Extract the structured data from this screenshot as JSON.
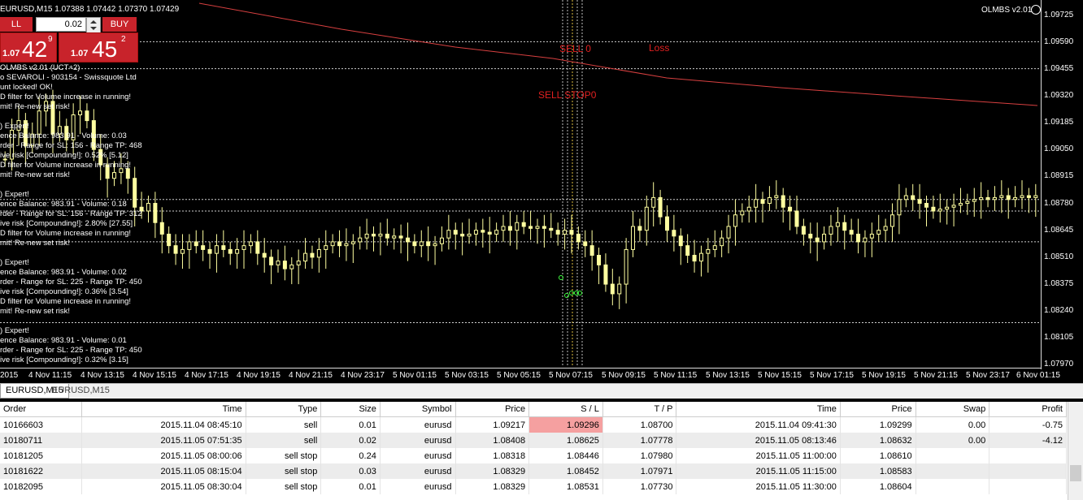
{
  "window": {
    "symbol_info": "EURUSD,M15  1.07388 1.07442 1.07370 1.07429",
    "ea_badge": "OLMBS v2.01"
  },
  "trade_panel": {
    "sell_label": "LL",
    "buy_label": "BUY",
    "lot_value": "0.02",
    "sell_quote": {
      "small": "1.07",
      "big": "42",
      "sup": "9"
    },
    "buy_quote": {
      "small": "1.07",
      "big": "45",
      "sup": "2"
    }
  },
  "comment_lines": [
    "OLMBS v2.01 (UCT+2)",
    "o SEVAROLI - 903154 - Swissquote Ltd",
    "unt locked! OK!",
    "D filter for Volume increase in running!",
    "mit! Re-new set risk!",
    "",
    ") Expert!",
    "ence Balance: 983.91 - Volume: 0.03",
    "rder - Range for SL: 156 - Range TP: 468",
    "ive risk [Compounding!]: 0.52% [5.12]",
    "D filter for Volume increase in running!",
    "mit! Re-new set risk!",
    "",
    ") Expert!",
    "ence Balance: 983.91 - Volume: 0.18",
    "rder - Range for SL: 156 - Range TP: 312",
    "ive risk [Compounding!]: 2.80% [27.55]",
    "D filter for Volume increase in running!",
    "mit! Re-new set risk!",
    "",
    ") Expert!",
    "ence Balance: 983.91 - Volume: 0.02",
    "rder - Range for SL: 225 - Range TP: 450",
    "ive risk [Compounding!]: 0.36% [3.54]",
    "D filter for Volume increase in running!",
    "mit! Re-new set risk!",
    "",
    ") Expert!",
    "ence Balance: 983.91 - Volume: 0.01",
    "rder - Range for SL: 225 - Range TP: 450",
    "ive risk [Compounding!]: 0.32% [3.15]"
  ],
  "chart_labels": {
    "sell0": "SELL 0",
    "loss": "Loss",
    "sell_stop": "SELL STOP0"
  },
  "price_ticks": [
    "1.09725",
    "1.09590",
    "1.09455",
    "1.09320",
    "1.09185",
    "1.09050",
    "1.08915",
    "1.08780",
    "1.08645",
    "1.08510",
    "1.08375",
    "1.08240",
    "1.08105",
    "1.07970"
  ],
  "time_ticks": [
    "2015",
    "4 Nov 11:15",
    "4 Nov 13:15",
    "4 Nov 15:15",
    "4 Nov 17:15",
    "4 Nov 19:15",
    "4 Nov 21:15",
    "4 Nov 23:17",
    "5 Nov 01:15",
    "5 Nov 03:15",
    "5 Nov 05:15",
    "5 Nov 07:15",
    "5 Nov 09:15",
    "5 Nov 11:15",
    "5 Nov 13:15",
    "5 Nov 15:15",
    "5 Nov 17:15",
    "5 Nov 19:15",
    "5 Nov 21:15",
    "5 Nov 23:17",
    "6 Nov 01:15"
  ],
  "chart_data": {
    "type": "candlestick",
    "symbol": "EURUSD",
    "timeframe": "M15",
    "ylim": [
      1.0797,
      1.0986
    ],
    "horizontal_levels": [
      1.0966,
      1.0952,
      1.0884,
      1.0878,
      1.0862,
      1.082
    ],
    "closes": [
      1.0905,
      1.092,
      1.0925,
      1.0912,
      1.0918,
      1.093,
      1.0935,
      1.0918,
      1.0922,
      1.0915,
      1.0928,
      1.093,
      1.0925,
      1.091,
      1.0902,
      1.0895,
      1.0898,
      1.09,
      1.0895,
      1.088,
      1.0878,
      1.0882,
      1.0872,
      1.0866,
      1.086,
      1.0856,
      1.0858,
      1.0862,
      1.086,
      1.0858,
      1.0856,
      1.086,
      1.0858,
      1.0856,
      1.0858,
      1.086,
      1.0862,
      1.0856,
      1.0854,
      1.085,
      1.0852,
      1.0848,
      1.085,
      1.0852,
      1.0856,
      1.0854,
      1.0858,
      1.086,
      1.0862,
      1.086,
      1.0861,
      1.0862,
      1.0864,
      1.0866,
      1.0865,
      1.0866,
      1.0864,
      1.0865,
      1.0864,
      1.0862,
      1.086,
      1.0862,
      1.086,
      1.0861,
      1.0864,
      1.0868,
      1.0866,
      1.0865,
      1.0866,
      1.0868,
      1.0867,
      1.0866,
      1.0868,
      1.087,
      1.0868,
      1.0872,
      1.087,
      1.0869,
      1.087,
      1.0869,
      1.0868,
      1.0866,
      1.0868,
      1.0866,
      1.0862,
      1.086,
      1.0855,
      1.085,
      1.084,
      1.0835,
      1.084,
      1.0858,
      1.087,
      1.0868,
      1.088,
      1.0885,
      1.0875,
      1.0868,
      1.0865,
      1.086,
      1.0855,
      1.0852,
      1.0856,
      1.0858,
      1.086,
      1.0864,
      1.087,
      1.0876,
      1.0878,
      1.088,
      1.0884,
      1.0882,
      1.0885,
      1.0886,
      1.088,
      1.0878,
      1.087,
      1.0866,
      1.0864,
      1.0862,
      1.0866,
      1.087,
      1.0872,
      1.0868,
      1.0866,
      1.0862,
      1.0864,
      1.0866,
      1.0868,
      1.087,
      1.0876,
      1.0884,
      1.0886,
      1.0884,
      1.0882,
      1.088,
      1.0878,
      1.0879,
      1.088,
      1.0881,
      1.0882,
      1.0883,
      1.0884,
      1.0885,
      1.0884,
      1.0885,
      1.0886,
      1.0884,
      1.0885,
      1.0886,
      1.0885,
      1.0886
    ]
  },
  "tabs": {
    "active": "EURUSD,M15",
    "inactive": "EURUSD,M15"
  },
  "orders": {
    "columns": [
      "Order",
      "Time",
      "Type",
      "Size",
      "Symbol",
      "Price",
      "S / L",
      "T / P",
      "Time",
      "Price",
      "Swap",
      "Profit"
    ],
    "rows": [
      [
        "10166603",
        "2015.11.04 08:45:10",
        "sell",
        "0.01",
        "eurusd",
        "1.09217",
        "1.09296",
        "1.08700",
        "2015.11.04 09:41:30",
        "1.09299",
        "0.00",
        "-0.75"
      ],
      [
        "10180711",
        "2015.11.05 07:51:35",
        "sell",
        "0.02",
        "eurusd",
        "1.08408",
        "1.08625",
        "1.07778",
        "2015.11.05 08:13:46",
        "1.08632",
        "0.00",
        "-4.12"
      ],
      [
        "10181205",
        "2015.11.05 08:00:06",
        "sell stop",
        "0.24",
        "eurusd",
        "1.08318",
        "1.08446",
        "1.07980",
        "2015.11.05 11:00:00",
        "1.08610",
        "",
        ""
      ],
      [
        "10181622",
        "2015.11.05 08:15:04",
        "sell stop",
        "0.03",
        "eurusd",
        "1.08329",
        "1.08452",
        "1.07971",
        "2015.11.05 11:15:00",
        "1.08583",
        "",
        ""
      ],
      [
        "10182095",
        "2015.11.05 08:30:04",
        "sell stop",
        "0.01",
        "eurusd",
        "1.08329",
        "1.08531",
        "1.07730",
        "2015.11.05 11:30:00",
        "1.08604",
        "",
        ""
      ]
    ]
  },
  "colors": {
    "background": "#000000",
    "candle": "#ffffa0",
    "level_line": "#d0d0d0",
    "trend_line": "#d84040",
    "sell_red": "#c8232b",
    "sl_highlight": "#f5a0a0"
  }
}
